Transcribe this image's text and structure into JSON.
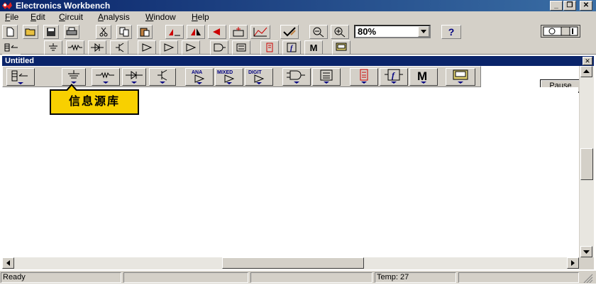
{
  "window": {
    "title": "Electronics Workbench",
    "controls": [
      "_",
      "❐",
      "✕"
    ]
  },
  "menu": [
    {
      "label": "File",
      "accel": "F",
      "rest": "ile"
    },
    {
      "label": "Edit",
      "accel": "E",
      "rest": "dit"
    },
    {
      "label": "Circuit",
      "accel": "C",
      "rest": "ircuit"
    },
    {
      "label": "Analysis",
      "accel": "A",
      "rest": "nalysis"
    },
    {
      "label": "Window",
      "accel": "W",
      "rest": "indow"
    },
    {
      "label": "Help",
      "accel": "H",
      "rest": "elp"
    }
  ],
  "toolbar": {
    "zoom_value": "80%",
    "help_label": "?",
    "pause_label": "Pause",
    "power_label": "O I"
  },
  "document": {
    "title": "Untitled",
    "close_label": "✕"
  },
  "parts_bin": {
    "analog_label": "ANA",
    "mixed_label": "MIXED",
    "digital_label": "DIGIT",
    "misc_label": "M",
    "func_label": "f"
  },
  "tooltip": {
    "text": "信息源库"
  },
  "status": {
    "message": "Ready",
    "temp": "Temp:  27"
  }
}
